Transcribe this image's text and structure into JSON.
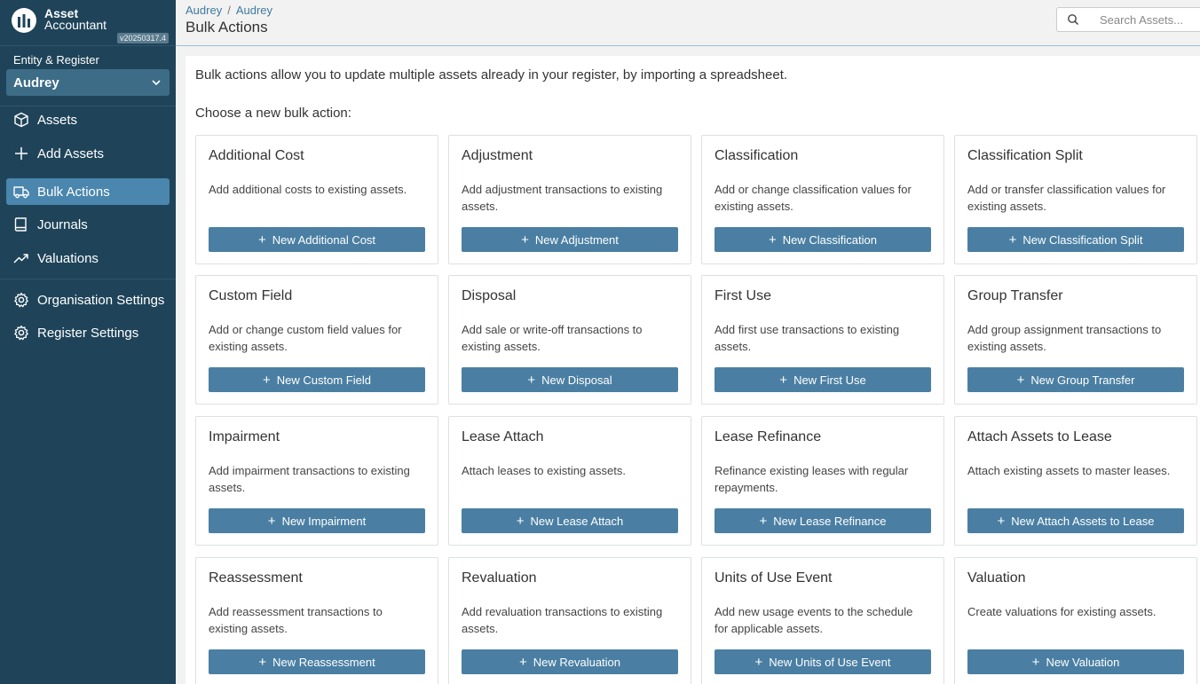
{
  "app": {
    "logo_line1": "Asset",
    "logo_line2": "Accountant",
    "version": "v20250317.4"
  },
  "sidebar": {
    "entity_label": "Entity & Register",
    "entity_value": "Audrey",
    "items": [
      {
        "label": "Assets",
        "icon": "cube-icon",
        "active": false
      },
      {
        "label": "Add Assets",
        "icon": "plus-icon",
        "active": false
      },
      {
        "label": "Bulk Actions",
        "icon": "truck-icon",
        "active": true
      },
      {
        "label": "Journals",
        "icon": "book-icon",
        "active": false
      },
      {
        "label": "Valuations",
        "icon": "trend-up-icon",
        "active": false
      },
      {
        "label": "Organisation Settings",
        "icon": "gear-icon",
        "active": false
      },
      {
        "label": "Register Settings",
        "icon": "gear-icon",
        "active": false
      }
    ]
  },
  "header": {
    "breadcrumb": [
      "Audrey",
      "Audrey"
    ],
    "breadcrumb_sep": "/",
    "title": "Bulk Actions",
    "search_placeholder": "Search Assets..."
  },
  "main": {
    "intro": "Bulk actions allow you to update multiple assets already in your register, by importing a spreadsheet.",
    "choose": "Choose a new bulk action:",
    "cards": [
      {
        "title": "Additional Cost",
        "desc": "Add additional costs to existing assets.",
        "button": "New Additional Cost"
      },
      {
        "title": "Adjustment",
        "desc": "Add adjustment transactions to existing assets.",
        "button": "New Adjustment"
      },
      {
        "title": "Classification",
        "desc": "Add or change classification values for existing assets.",
        "button": "New Classification"
      },
      {
        "title": "Classification Split",
        "desc": "Add or transfer classification values for existing assets.",
        "button": "New Classification Split"
      },
      {
        "title": "Custom Field",
        "desc": "Add or change custom field values for existing assets.",
        "button": "New Custom Field"
      },
      {
        "title": "Disposal",
        "desc": "Add sale or write-off transactions to existing assets.",
        "button": "New Disposal"
      },
      {
        "title": "First Use",
        "desc": "Add first use transactions to existing assets.",
        "button": "New First Use"
      },
      {
        "title": "Group Transfer",
        "desc": "Add group assignment transactions to existing assets.",
        "button": "New Group Transfer"
      },
      {
        "title": "Impairment",
        "desc": "Add impairment transactions to existing assets.",
        "button": "New Impairment"
      },
      {
        "title": "Lease Attach",
        "desc": "Attach leases to existing assets.",
        "button": "New Lease Attach"
      },
      {
        "title": "Lease Refinance",
        "desc": "Refinance existing leases with regular repayments.",
        "button": "New Lease Refinance"
      },
      {
        "title": "Attach Assets to Lease",
        "desc": "Attach existing assets to master leases.",
        "button": "New Attach Assets to Lease"
      },
      {
        "title": "Reassessment",
        "desc": "Add reassessment transactions to existing assets.",
        "button": "New Reassessment"
      },
      {
        "title": "Revaluation",
        "desc": "Add revaluation transactions to existing assets.",
        "button": "New Revaluation"
      },
      {
        "title": "Units of Use Event",
        "desc": "Add new usage events to the schedule for applicable assets.",
        "button": "New Units of Use Event"
      },
      {
        "title": "Valuation",
        "desc": "Create valuations for existing assets.",
        "button": "New Valuation"
      }
    ]
  },
  "colors": {
    "sidebar_bg": "#1f4459",
    "nav_active": "#4a86ad",
    "button": "#4a7fa3",
    "link": "#3f7aa0"
  }
}
